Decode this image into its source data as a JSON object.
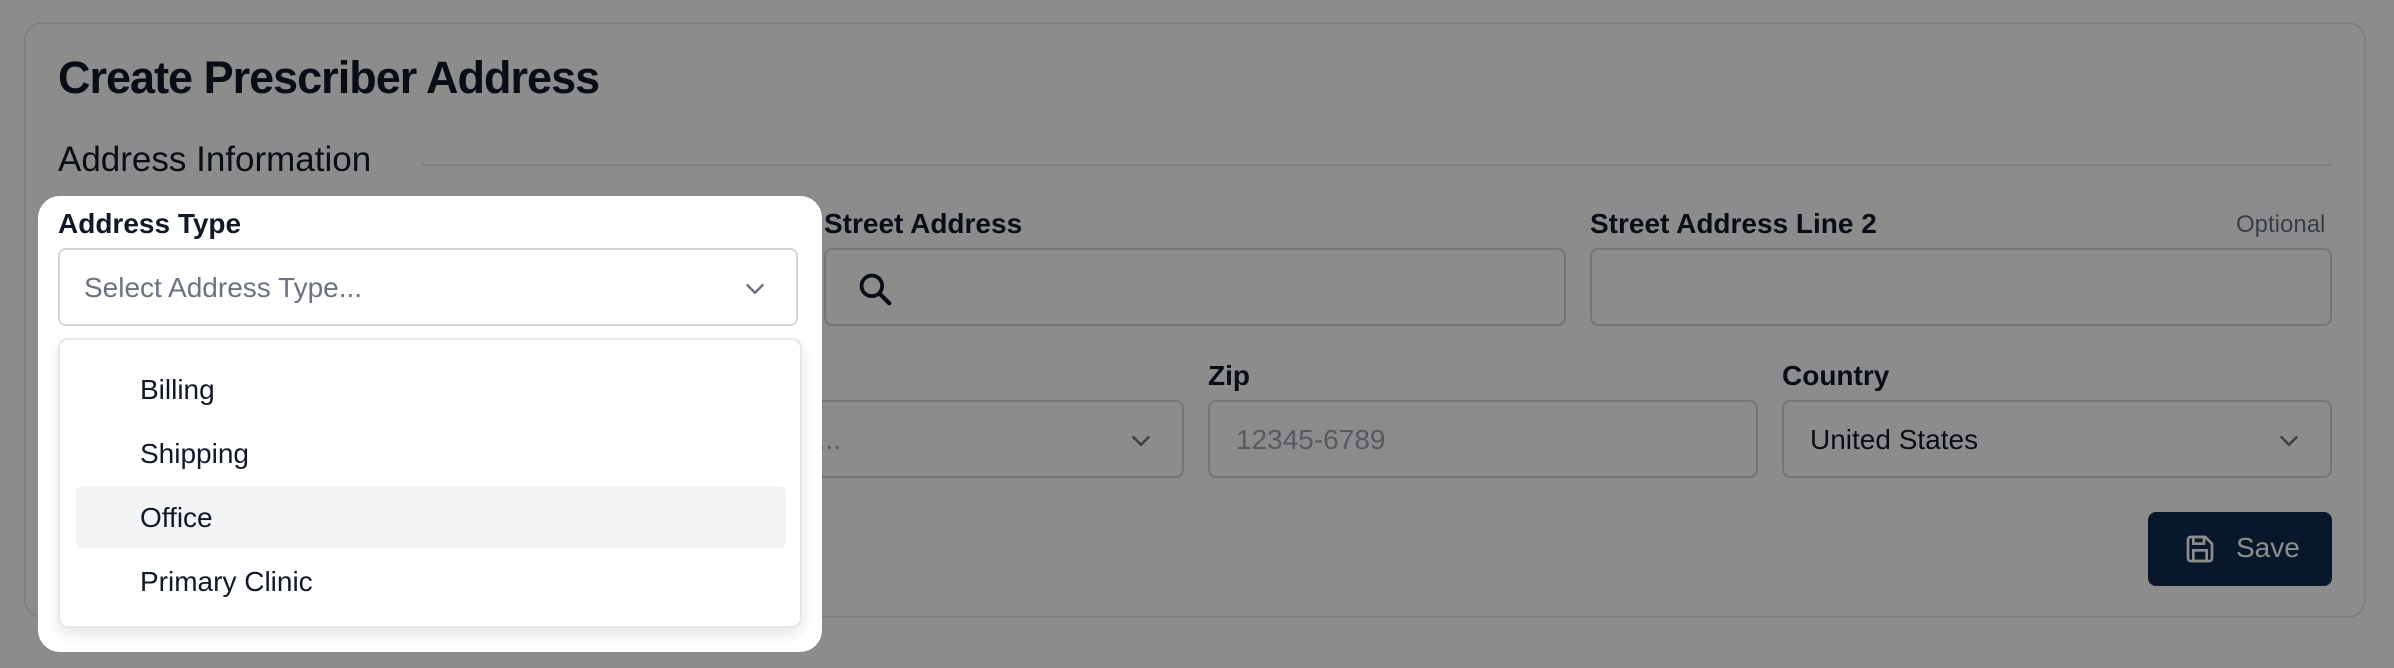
{
  "page": {
    "title": "Create Prescriber Address",
    "section_title": "Address Information"
  },
  "fields": {
    "address_type": {
      "label": "Address Type",
      "placeholder": "Select Address Type..."
    },
    "street_address": {
      "label": "Street Address"
    },
    "street_address_2": {
      "label": "Street Address Line 2",
      "optional": "Optional"
    },
    "state": {
      "placeholder_partial": "e..."
    },
    "zip": {
      "label": "Zip",
      "placeholder": "12345-6789"
    },
    "country": {
      "label": "Country",
      "value": "United States"
    }
  },
  "dropdown": {
    "options": [
      "Billing",
      "Shipping",
      "Office",
      "Primary Clinic"
    ],
    "highlighted": "Office"
  },
  "actions": {
    "save_label": "Save"
  },
  "colors": {
    "primary_button": "#0f2b4c",
    "highlight": "#f3f4f6",
    "border": "#d1d5db"
  },
  "icons": [
    "search-icon",
    "chevron-down-icon",
    "save-icon"
  ]
}
